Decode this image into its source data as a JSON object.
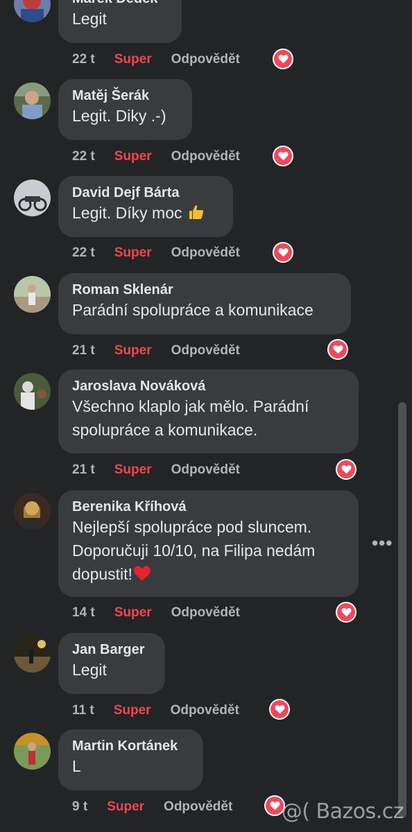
{
  "comments": [
    {
      "author": "Marek Dědek",
      "text": "Legit",
      "time": "22 t",
      "reaction": "Super",
      "reply": "Odpovědět",
      "heart_color": "#f0475a"
    },
    {
      "author": "Matěj Šerák",
      "text": "Legit. Diky .-)",
      "time": "22 t",
      "reaction": "Super",
      "reply": "Odpovědět"
    },
    {
      "author": "David Dejf Bárta",
      "text": "Legit. Díky moc",
      "emoji": "thumbs-up",
      "time": "22 t",
      "reaction": "Super",
      "reply": "Odpovědět"
    },
    {
      "author": "Roman Sklenár",
      "text": "Parádní spolupráce a komunikace",
      "time": "21 t",
      "reaction": "Super",
      "reply": "Odpovědět"
    },
    {
      "author": "Jaroslava Nováková",
      "text_lines": [
        "Všechno klaplo jak mělo. Parádní",
        "spolupráce a komunikace."
      ],
      "time": "21 t",
      "reaction": "Super",
      "reply": "Odpovědět"
    },
    {
      "author": "Berenika Kříhová",
      "text_lines": [
        "Nejlepší spolupráce pod sluncem.",
        "Doporučuji 10/10, na Filipa nedám",
        "dopustit!"
      ],
      "emoji": "red-heart",
      "time": "14 t",
      "reaction": "Super",
      "reply": "Odpovědět"
    },
    {
      "author": "Jan Barger",
      "text": "Legit",
      "time": "11 t",
      "reaction": "Super",
      "reply": "Odpovědět"
    },
    {
      "author": "Martin Kortánek",
      "text": "L",
      "time": "9 t",
      "reaction": "Super",
      "reply": "Odpovědět"
    }
  ],
  "more_options": "•••",
  "watermark": "@( Bazos.cz",
  "colors": {
    "background": "#232425",
    "bubble": "#3a3b3c",
    "reaction_red": "#f0474f",
    "meta_gray": "#b0b3b8",
    "heart": "#f0475a"
  }
}
